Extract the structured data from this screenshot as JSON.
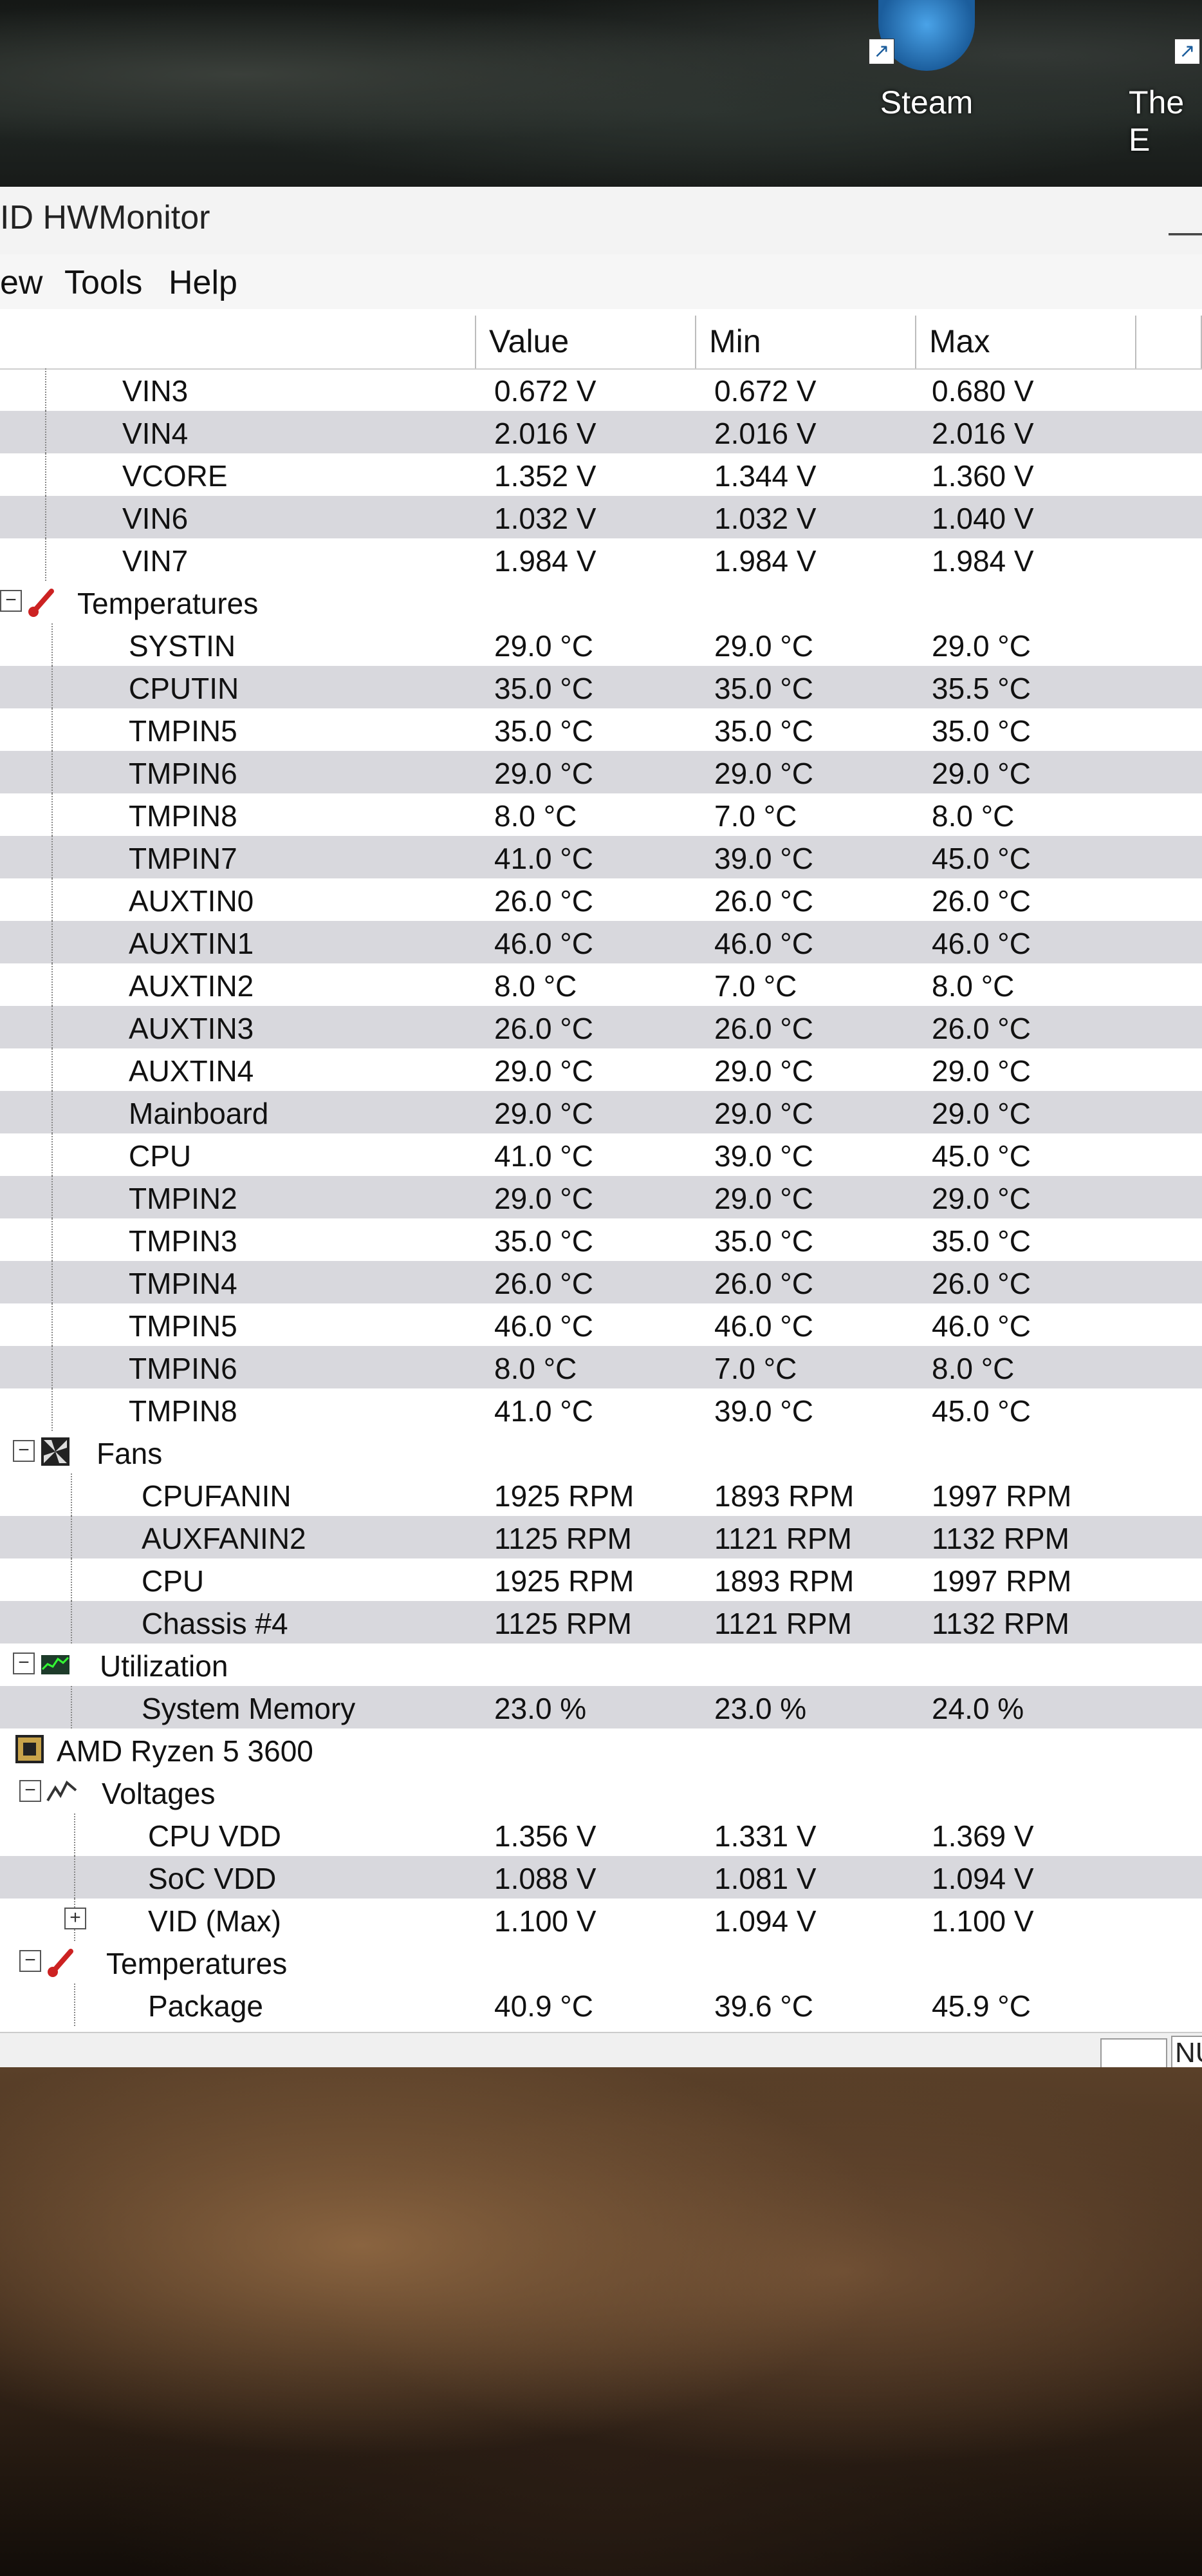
{
  "desktop": {
    "icons": [
      {
        "label": "Steam"
      },
      {
        "label": "The E"
      }
    ]
  },
  "window": {
    "title": "ID HWMonitor",
    "title_right": "—"
  },
  "menu": [
    "ew",
    "Tools",
    "Help"
  ],
  "columns": {
    "value": "Value",
    "min": "Min",
    "max": "Max"
  },
  "rows": [
    {
      "label": "VIN3",
      "value": "0.672 V",
      "min": "0.672 V",
      "max": "0.680 V"
    },
    {
      "label": "VIN4",
      "value": "2.016 V",
      "min": "2.016 V",
      "max": "2.016 V"
    },
    {
      "label": "VCORE",
      "value": "1.352 V",
      "min": "1.344 V",
      "max": "1.360 V"
    },
    {
      "label": "VIN6",
      "value": "1.032 V",
      "min": "1.032 V",
      "max": "1.040 V"
    },
    {
      "label": "VIN7",
      "value": "1.984 V",
      "min": "1.984 V",
      "max": "1.984 V"
    },
    {
      "label": "Temperatures",
      "group": true,
      "icon": "thermometer-icon"
    },
    {
      "label": "SYSTIN",
      "value": "29.0 °C",
      "min": "29.0 °C",
      "max": "29.0 °C"
    },
    {
      "label": "CPUTIN",
      "value": "35.0 °C",
      "min": "35.0 °C",
      "max": "35.5 °C"
    },
    {
      "label": "TMPIN5",
      "value": "35.0 °C",
      "min": "35.0 °C",
      "max": "35.0 °C"
    },
    {
      "label": "TMPIN6",
      "value": "29.0 °C",
      "min": "29.0 °C",
      "max": "29.0 °C"
    },
    {
      "label": "TMPIN8",
      "value": "8.0 °C",
      "min": "7.0 °C",
      "max": "8.0 °C"
    },
    {
      "label": "TMPIN7",
      "value": "41.0 °C",
      "min": "39.0 °C",
      "max": "45.0 °C"
    },
    {
      "label": "AUXTIN0",
      "value": "26.0 °C",
      "min": "26.0 °C",
      "max": "26.0 °C"
    },
    {
      "label": "AUXTIN1",
      "value": "46.0 °C",
      "min": "46.0 °C",
      "max": "46.0 °C"
    },
    {
      "label": "AUXTIN2",
      "value": "8.0 °C",
      "min": "7.0 °C",
      "max": "8.0 °C"
    },
    {
      "label": "AUXTIN3",
      "value": "26.0 °C",
      "min": "26.0 °C",
      "max": "26.0 °C"
    },
    {
      "label": "AUXTIN4",
      "value": "29.0 °C",
      "min": "29.0 °C",
      "max": "29.0 °C"
    },
    {
      "label": "Mainboard",
      "value": "29.0 °C",
      "min": "29.0 °C",
      "max": "29.0 °C"
    },
    {
      "label": "CPU",
      "value": "41.0 °C",
      "min": "39.0 °C",
      "max": "45.0 °C"
    },
    {
      "label": "TMPIN2",
      "value": "29.0 °C",
      "min": "29.0 °C",
      "max": "29.0 °C"
    },
    {
      "label": "TMPIN3",
      "value": "35.0 °C",
      "min": "35.0 °C",
      "max": "35.0 °C"
    },
    {
      "label": "TMPIN4",
      "value": "26.0 °C",
      "min": "26.0 °C",
      "max": "26.0 °C"
    },
    {
      "label": "TMPIN5",
      "value": "46.0 °C",
      "min": "46.0 °C",
      "max": "46.0 °C"
    },
    {
      "label": "TMPIN6",
      "value": "8.0 °C",
      "min": "7.0 °C",
      "max": "8.0 °C"
    },
    {
      "label": "TMPIN8",
      "value": "41.0 °C",
      "min": "39.0 °C",
      "max": "45.0 °C"
    },
    {
      "label": "Fans",
      "group": true,
      "icon": "fan-icon"
    },
    {
      "label": "CPUFANIN",
      "value": "1925 RPM",
      "min": "1893 RPM",
      "max": "1997 RPM"
    },
    {
      "label": "AUXFANIN2",
      "value": "1125 RPM",
      "min": "1121 RPM",
      "max": "1132 RPM"
    },
    {
      "label": "CPU",
      "value": "1925 RPM",
      "min": "1893 RPM",
      "max": "1997 RPM"
    },
    {
      "label": "Chassis #4",
      "value": "1125 RPM",
      "min": "1121 RPM",
      "max": "1132 RPM"
    },
    {
      "label": "Utilization",
      "group": true,
      "icon": "utilization-icon"
    },
    {
      "label": "System Memory",
      "value": "23.0 %",
      "min": "23.0 %",
      "max": "24.0 %"
    },
    {
      "label": "AMD Ryzen 5 3600",
      "group": true,
      "device": true,
      "icon": "chip-icon"
    },
    {
      "label": "Voltages",
      "group": true,
      "icon": "voltage-icon"
    },
    {
      "label": "CPU VDD",
      "value": "1.356 V",
      "min": "1.331 V",
      "max": "1.369 V"
    },
    {
      "label": "SoC VDD",
      "value": "1.088 V",
      "min": "1.081 V",
      "max": "1.094 V"
    },
    {
      "label": "VID (Max)",
      "value": "1.100 V",
      "min": "1.094 V",
      "max": "1.100 V",
      "expandable": true
    },
    {
      "label": "Temperatures",
      "group": true,
      "icon": "thermometer-icon"
    },
    {
      "label": "Package",
      "value": "40.9 °C",
      "min": "39.6 °C",
      "max": "45.9 °C"
    }
  ],
  "status": {
    "indicator": "NU"
  }
}
